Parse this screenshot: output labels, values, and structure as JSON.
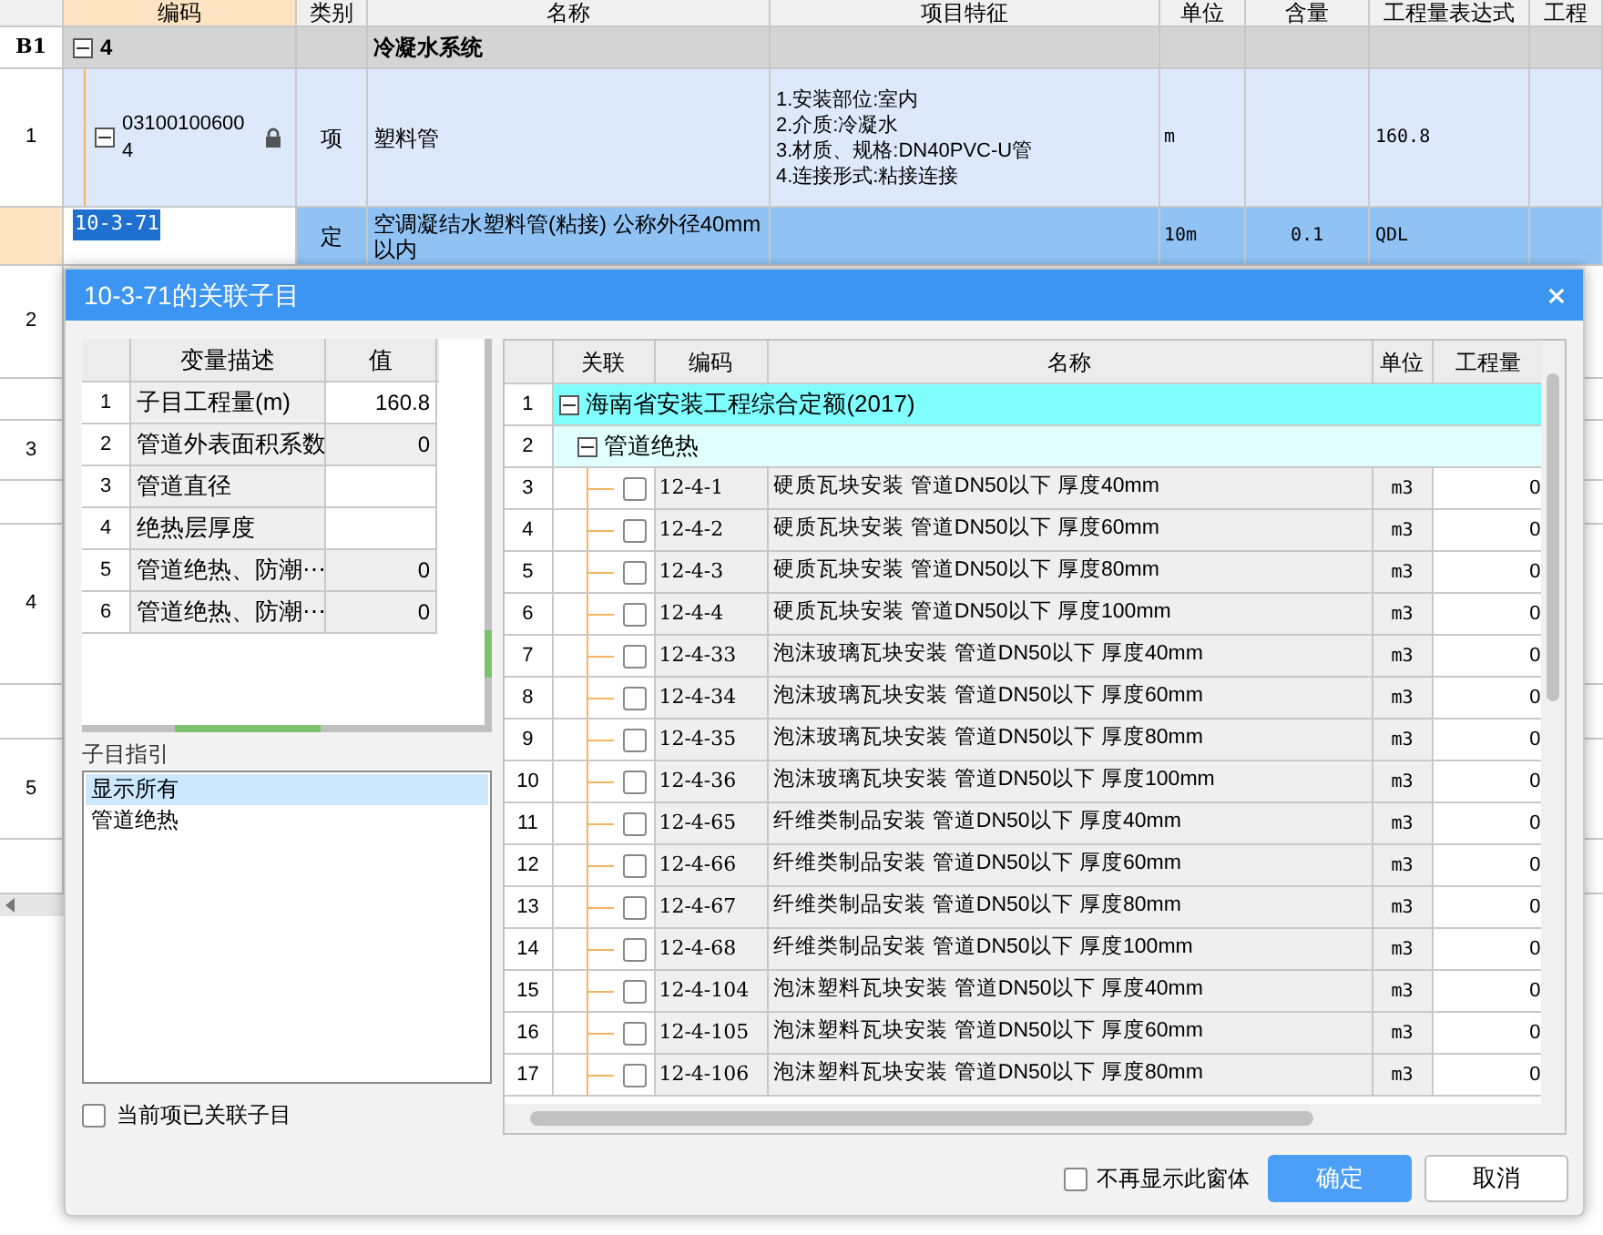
{
  "sheet": {
    "columns": [
      "编码",
      "类别",
      "名称",
      "项目特征",
      "单位",
      "含量",
      "工程量表达式",
      "工程"
    ],
    "rows": [
      {
        "kind": "section",
        "row_number": "B1",
        "code": "4",
        "expanded": true,
        "name": "冷凝水系统"
      },
      {
        "kind": "item",
        "row_number": "1",
        "code": "03100100600 4",
        "expanded": true,
        "locked": true,
        "type": "项",
        "name": "塑料管",
        "features": [
          "1.安装部位:室内",
          "2.介质:冷凝水",
          "3.材质、规格:DN40PVC-U管",
          "4.连接形式:粘接连接"
        ],
        "unit": "m",
        "expression": "160.8"
      },
      {
        "kind": "quota",
        "selected": true,
        "code": "10-3-71",
        "type": "定",
        "name": "空调凝结水塑料管(粘接) 公称外径40mm以内",
        "unit": "10m",
        "content": "0.1",
        "expression": "QDL"
      }
    ],
    "hidden_row_numbers": [
      "2",
      "3",
      "4",
      "5"
    ]
  },
  "dialog": {
    "title": "10-3-71的关联子目",
    "variables": {
      "columns": [
        "变量描述",
        "值"
      ],
      "rows": [
        {
          "number": "1",
          "name": "子目工程量(m)",
          "value": "160.8",
          "editable": true
        },
        {
          "number": "2",
          "name": "管道外表面积系数",
          "value": "0",
          "editable": false
        },
        {
          "number": "3",
          "name": "管道直径",
          "editable": true
        },
        {
          "number": "4",
          "name": "绝热层厚度",
          "editable": true
        },
        {
          "number": "5",
          "name": "管道绝热、防潮⋯",
          "value": "0",
          "editable": false
        },
        {
          "number": "6",
          "name": "管道绝热、防潮⋯",
          "value": "0",
          "editable": false
        }
      ]
    },
    "guide": {
      "label": "子目指引",
      "items": [
        {
          "label": "显示所有",
          "selected": true
        },
        {
          "label": "管道绝热",
          "selected": false
        }
      ]
    },
    "linked_only": {
      "label": "当前项已关联子目",
      "checked": false
    },
    "items": {
      "columns": [
        "关联",
        "编码",
        "名称",
        "单位",
        "工程量"
      ],
      "tree": [
        {
          "row_number": "1",
          "name": "海南省安装工程综合定额(2017)",
          "expanded": true,
          "children": [
            {
              "row_number": "2",
              "name": "管道绝热",
              "expanded": true,
              "children": [
                {
                  "row_number": "3",
                  "checked": false,
                  "code": "12-4-1",
                  "name": "硬质瓦块安装 管道DN50以下 厚度40mm",
                  "unit": "m3",
                  "quantity": "0"
                },
                {
                  "row_number": "4",
                  "checked": false,
                  "code": "12-4-2",
                  "name": "硬质瓦块安装 管道DN50以下 厚度60mm",
                  "unit": "m3",
                  "quantity": "0"
                },
                {
                  "row_number": "5",
                  "checked": false,
                  "code": "12-4-3",
                  "name": "硬质瓦块安装 管道DN50以下 厚度80mm",
                  "unit": "m3",
                  "quantity": "0"
                },
                {
                  "row_number": "6",
                  "checked": false,
                  "code": "12-4-4",
                  "name": "硬质瓦块安装 管道DN50以下 厚度100mm",
                  "unit": "m3",
                  "quantity": "0"
                },
                {
                  "row_number": "7",
                  "checked": false,
                  "code": "12-4-33",
                  "name": "泡沫玻璃瓦块安装 管道DN50以下 厚度40mm",
                  "unit": "m3",
                  "quantity": "0"
                },
                {
                  "row_number": "8",
                  "checked": false,
                  "code": "12-4-34",
                  "name": "泡沫玻璃瓦块安装 管道DN50以下 厚度60mm",
                  "unit": "m3",
                  "quantity": "0"
                },
                {
                  "row_number": "9",
                  "checked": false,
                  "code": "12-4-35",
                  "name": "泡沫玻璃瓦块安装 管道DN50以下 厚度80mm",
                  "unit": "m3",
                  "quantity": "0"
                },
                {
                  "row_number": "10",
                  "checked": false,
                  "code": "12-4-36",
                  "name": "泡沫玻璃瓦块安装 管道DN50以下 厚度100mm",
                  "unit": "m3",
                  "quantity": "0"
                },
                {
                  "row_number": "11",
                  "checked": false,
                  "code": "12-4-65",
                  "name": "纤维类制品安装 管道DN50以下 厚度40mm",
                  "unit": "m3",
                  "quantity": "0"
                },
                {
                  "row_number": "12",
                  "checked": false,
                  "code": "12-4-66",
                  "name": "纤维类制品安装 管道DN50以下 厚度60mm",
                  "unit": "m3",
                  "quantity": "0"
                },
                {
                  "row_number": "13",
                  "checked": false,
                  "code": "12-4-67",
                  "name": "纤维类制品安装 管道DN50以下 厚度80mm",
                  "unit": "m3",
                  "quantity": "0"
                },
                {
                  "row_number": "14",
                  "checked": false,
                  "code": "12-4-68",
                  "name": "纤维类制品安装 管道DN50以下 厚度100mm",
                  "unit": "m3",
                  "quantity": "0"
                },
                {
                  "row_number": "15",
                  "checked": false,
                  "code": "12-4-104",
                  "name": "泡沫塑料瓦块安装 管道DN50以下 厚度40mm",
                  "unit": "m3",
                  "quantity": "0"
                },
                {
                  "row_number": "16",
                  "checked": false,
                  "code": "12-4-105",
                  "name": "泡沫塑料瓦块安装 管道DN50以下 厚度60mm",
                  "unit": "m3",
                  "quantity": "0"
                },
                {
                  "row_number": "17",
                  "checked": false,
                  "code": "12-4-106",
                  "name": "泡沫塑料瓦块安装 管道DN50以下 厚度80mm",
                  "unit": "m3",
                  "quantity": "0"
                }
              ]
            }
          ]
        }
      ]
    },
    "dont_show_again": {
      "label": "不再显示此窗体",
      "checked": false
    },
    "buttons": [
      {
        "label": "确定",
        "kind": "primary"
      },
      {
        "label": "取消",
        "kind": "secondary"
      }
    ]
  }
}
